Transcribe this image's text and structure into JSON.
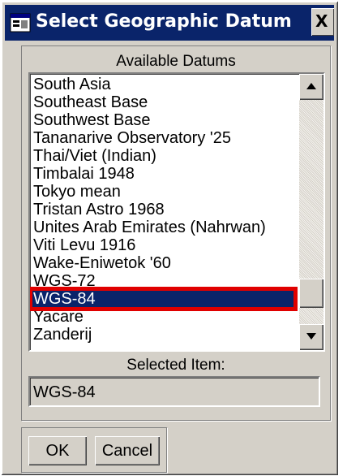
{
  "window": {
    "title": "Select Geographic Datum",
    "close_label": "X",
    "title_icon": "dialog-window-icon",
    "colors": {
      "titlebar": "#0a246a",
      "face": "#d4d0c8",
      "selection": "#0a246a",
      "highlight_box": "#e00000"
    }
  },
  "list": {
    "caption": "Available Datums",
    "items": [
      "South Asia",
      "Southeast Base",
      "Southwest Base",
      "Tananarive Observatory '25",
      "Thai/Viet (Indian)",
      "Timbalai 1948",
      "Tokyo mean",
      "Tristan Astro 1968",
      "Unites Arab Emirates (Nahrwan)",
      "Viti Levu 1916",
      "Wake-Eniwetok '60",
      "WGS-72",
      "WGS-84",
      "Yacare",
      "Zanderij"
    ],
    "selected_index": 12,
    "scroll_up_icon": "arrow-up-icon",
    "scroll_down_icon": "arrow-down-icon"
  },
  "selection": {
    "caption": "Selected Item:",
    "value": "WGS-84"
  },
  "buttons": {
    "ok": "OK",
    "cancel": "Cancel"
  }
}
